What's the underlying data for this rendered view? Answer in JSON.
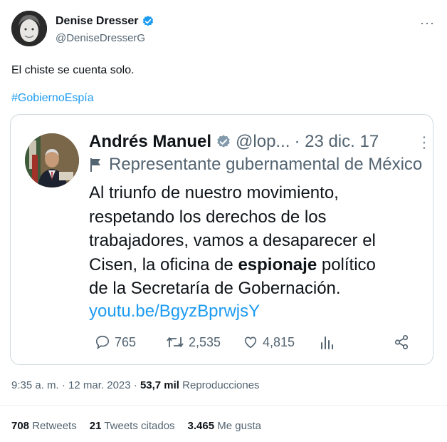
{
  "author": {
    "name": "Denise Dresser",
    "handle": "@DeniseDresserG",
    "more": "···"
  },
  "tweet": {
    "text": "El chiste se cuenta solo.",
    "hashtag": "#GobiernoEspía"
  },
  "quoted": {
    "name": "Andrés Manuel",
    "handle": "@lop...",
    "date": "· 23 dic. 17",
    "more": "⋮",
    "label": "Representante gubernamental de México",
    "lines": {
      "l1": "Al triunfo de nuestro movimiento,",
      "l2": "respetando los derechos de los",
      "l3": "trabajadores, vamos a desaparecer el",
      "l4a": "Cisen, la oficina de ",
      "l4b": "espionaje",
      "l4c": " político",
      "l5": "de la Secretaría de Gobernación."
    },
    "link": "youtu.be/BgyzBprwjsY",
    "actions": {
      "replies": "765",
      "retweets": "2,535",
      "likes": "4,815"
    }
  },
  "meta": {
    "time": "9:35 a. m. · 12 mar. 2023 · ",
    "views": "53,7 mil",
    "views_label": " Reproducciones"
  },
  "stats": {
    "retweets": "708",
    "retweets_label": " Retweets",
    "quotes": "21",
    "quotes_label": " Tweets citados",
    "likes": "3.465",
    "likes_label": " Me gusta"
  },
  "colors": {
    "accent": "#1d9bf0",
    "secondary_text": "#536471",
    "border": "#cfd9de"
  }
}
